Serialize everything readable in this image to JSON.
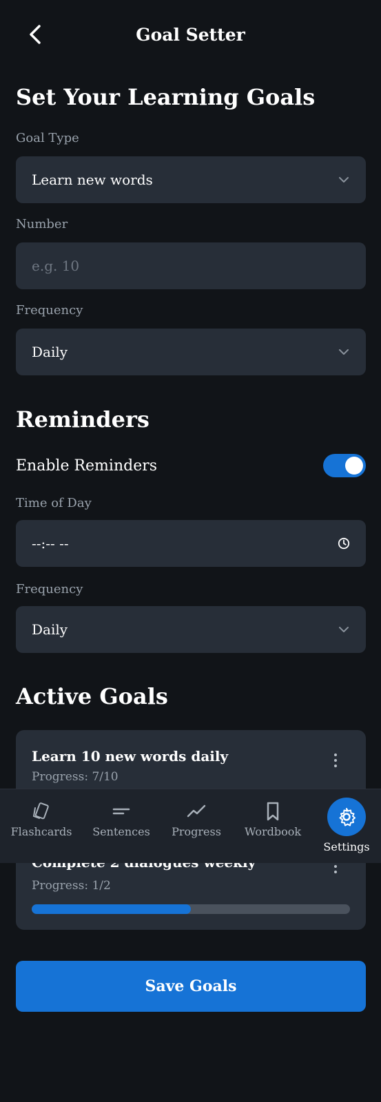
{
  "header": {
    "title": "Goal Setter"
  },
  "goals_section": {
    "title": "Set Your Learning Goals",
    "goal_type": {
      "label": "Goal Type",
      "value": "Learn new words"
    },
    "number": {
      "label": "Number",
      "placeholder": "e.g. 10"
    },
    "frequency": {
      "label": "Frequency",
      "value": "Daily"
    }
  },
  "reminders": {
    "title": "Reminders",
    "enable_label": "Enable Reminders",
    "enabled": true,
    "time_of_day": {
      "label": "Time of Day",
      "value": "--:-- --"
    },
    "frequency": {
      "label": "Frequency",
      "value": "Daily"
    }
  },
  "active_goals": {
    "title": "Active Goals",
    "items": [
      {
        "title": "Learn 10 new words daily",
        "progress_text": "Progress: 7/10",
        "progress": 0.7
      },
      {
        "title": "Complete 2 dialogues weekly",
        "progress_text": "Progress: 1/2",
        "progress": 0.5
      }
    ]
  },
  "nav": {
    "items": [
      {
        "label": "Flashcards",
        "icon": "flashcards-icon"
      },
      {
        "label": "Sentences",
        "icon": "sentences-icon"
      },
      {
        "label": "Progress",
        "icon": "progress-chart-icon"
      },
      {
        "label": "Wordbook",
        "icon": "bookmark-icon"
      },
      {
        "label": "Settings",
        "icon": "gear-icon",
        "active": true
      }
    ]
  },
  "save_button": {
    "label": "Save Goals"
  },
  "colors": {
    "accent": "#1673d6",
    "background": "#111418",
    "surface": "#272e38"
  }
}
